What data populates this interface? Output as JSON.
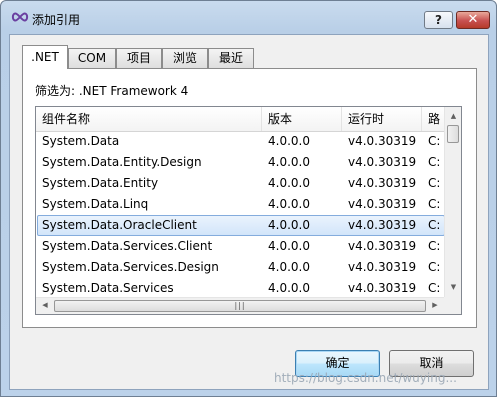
{
  "window": {
    "title": "添加引用",
    "help_label": "?",
    "close_label": "✕"
  },
  "tabs": [
    {
      "label": ".NET",
      "active": true
    },
    {
      "label": "COM",
      "active": false
    },
    {
      "label": "项目",
      "active": false
    },
    {
      "label": "浏览",
      "active": false
    },
    {
      "label": "最近",
      "active": false
    }
  ],
  "filter": {
    "text": "筛选为: .NET Framework 4"
  },
  "list": {
    "columns": [
      "组件名称",
      "版本",
      "运行时",
      "路"
    ],
    "rows": [
      {
        "name": "System.Data",
        "version": "4.0.0.0",
        "runtime": "v4.0.30319",
        "path": "C:"
      },
      {
        "name": "System.Data.Entity.Design",
        "version": "4.0.0.0",
        "runtime": "v4.0.30319",
        "path": "C:"
      },
      {
        "name": "System.Data.Entity",
        "version": "4.0.0.0",
        "runtime": "v4.0.30319",
        "path": "C:"
      },
      {
        "name": "System.Data.Linq",
        "version": "4.0.0.0",
        "runtime": "v4.0.30319",
        "path": "C:"
      },
      {
        "name": "System.Data.OracleClient",
        "version": "4.0.0.0",
        "runtime": "v4.0.30319",
        "path": "C:",
        "selected": true
      },
      {
        "name": "System.Data.Services.Client",
        "version": "4.0.0.0",
        "runtime": "v4.0.30319",
        "path": "C:"
      },
      {
        "name": "System.Data.Services.Design",
        "version": "4.0.0.0",
        "runtime": "v4.0.30319",
        "path": "C:"
      },
      {
        "name": "System.Data.Services",
        "version": "4.0.0.0",
        "runtime": "v4.0.30319",
        "path": "C:"
      }
    ],
    "scroll_up_glyph": "▲",
    "scroll_down_glyph": "▼",
    "scroll_left_glyph": "◀",
    "scroll_right_glyph": "▶",
    "grip_glyph": "|||"
  },
  "buttons": {
    "ok_label": "确定",
    "cancel_label": "取消"
  },
  "watermark": "https://blog.csdn.net/wuying..."
}
